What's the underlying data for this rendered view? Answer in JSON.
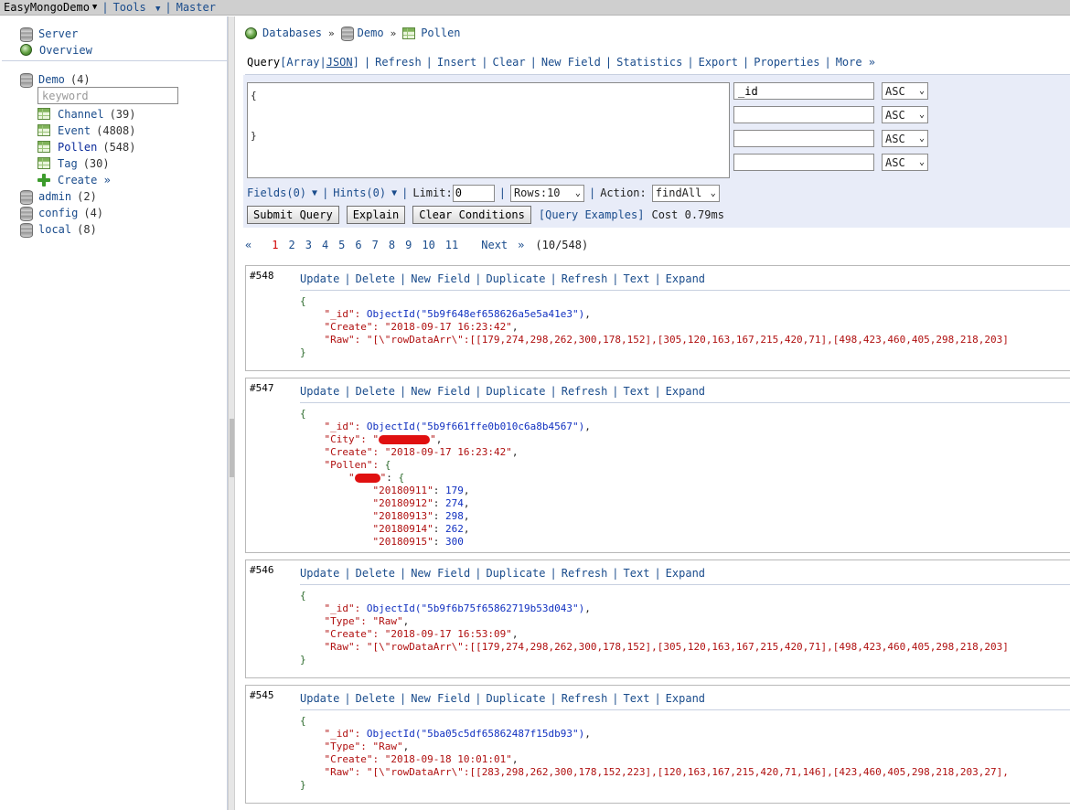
{
  "topbar": {
    "app_name": "EasyMongoDemo",
    "tools_label": "Tools",
    "master_label": "Master"
  },
  "sidebar": {
    "server_label": "Server",
    "overview_label": "Overview",
    "search_placeholder": "keyword",
    "databases": [
      {
        "name": "Demo",
        "count": "(4)"
      },
      {
        "name": "admin",
        "count": "(2)"
      },
      {
        "name": "config",
        "count": "(4)"
      },
      {
        "name": "local",
        "count": "(8)"
      }
    ],
    "collections": [
      {
        "name": "Channel",
        "count": "(39)"
      },
      {
        "name": "Event",
        "count": "(4808)"
      },
      {
        "name": "Pollen",
        "count": "(548)"
      },
      {
        "name": "Tag",
        "count": "(30)"
      }
    ],
    "create_label": "Create »"
  },
  "breadcrumb": {
    "databases": "Databases",
    "db": "Demo",
    "collection": "Pollen",
    "separator": "»"
  },
  "toolbar": {
    "query": "Query",
    "array": "[Array",
    "json": "JSON",
    "json_close": "]",
    "refresh": "Refresh",
    "insert": "Insert",
    "clear": "Clear",
    "new_field": "New Field",
    "statistics": "Statistics",
    "export": "Export",
    "properties": "Properties",
    "more": "More »"
  },
  "query": {
    "text": "{\n\n}",
    "sort_fields": [
      "_id",
      "",
      "",
      ""
    ],
    "sort_order": "ASC",
    "fields_label": "Fields(0)",
    "hints_label": "Hints(0)",
    "limit_label": "Limit:",
    "limit_value": "0",
    "rows_label": "Rows:10",
    "action_label": "Action:",
    "action_value": "findAll",
    "submit": "Submit Query",
    "explain": "Explain",
    "clear_conditions": "Clear Conditions",
    "examples": "[Query Examples]",
    "cost": "Cost 0.79ms"
  },
  "pager": {
    "prev": "«",
    "pages": [
      "1",
      "2",
      "3",
      "4",
      "5",
      "6",
      "7",
      "8",
      "9",
      "10",
      "11"
    ],
    "current": "1",
    "next": "Next",
    "last": "»",
    "summary": "(10/548)"
  },
  "record_actions": [
    "Update",
    "Delete",
    "New Field",
    "Duplicate",
    "Refresh",
    "Text",
    "Expand"
  ],
  "records": [
    {
      "num": "#548",
      "id": "5b9f648ef658626a5e5a41e3",
      "create": "\"2018-09-17 16:23:42\"",
      "raw": "\"[\\\"rowDataArr\\\":[[179,274,298,262,300,178,152],[305,120,163,167,215,420,71],[498,423,460,405,298,218,203]"
    },
    {
      "num": "#547",
      "id": "5b9f661ffe0b010c6a8b4567",
      "create": "\"2018-09-17 16:23:42\"",
      "pollen": [
        {
          "date": "\"20180911\"",
          "value": "179"
        },
        {
          "date": "\"20180912\"",
          "value": "274"
        },
        {
          "date": "\"20180913\"",
          "value": "298"
        },
        {
          "date": "\"20180914\"",
          "value": "262"
        },
        {
          "date": "\"20180915\"",
          "value": "300"
        }
      ]
    },
    {
      "num": "#546",
      "id": "5b9f6b75f65862719b53d043",
      "type": "\"Raw\"",
      "create": "\"2018-09-17 16:53:09\"",
      "raw": "\"[\\\"rowDataArr\\\":[[179,274,298,262,300,178,152],[305,120,163,167,215,420,71],[498,423,460,405,298,218,203]"
    },
    {
      "num": "#545",
      "id": "5ba05c5df65862487f15db93",
      "type": "\"Raw\"",
      "create": "\"2018-09-18 10:01:01\"",
      "raw": "\"[\\\"rowDataArr\\\":[[283,298,262,300,178,152,223],[120,163,167,215,420,71,146],[423,460,405,298,218,203,27],"
    }
  ],
  "keys": {
    "id": "\"_id\": ",
    "objectid": "ObjectId",
    "city": "\"City\": ",
    "create": "\"Create\": ",
    "raw": "\"Raw\": ",
    "type": "\"Type\": ",
    "pollen": "\"Pollen\": "
  }
}
